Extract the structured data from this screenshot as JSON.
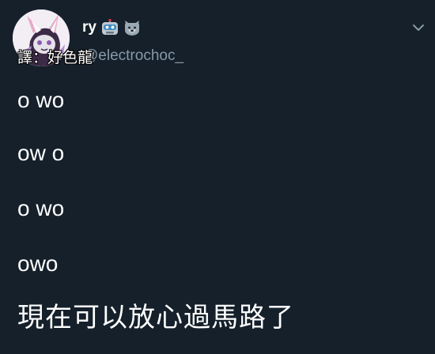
{
  "author": {
    "display_name": "ry",
    "handle": "@electrochoc_",
    "avatar_icon": "dragon-avatar-icon",
    "name_emojis": [
      "robot-face-icon",
      "wolf-face-icon"
    ]
  },
  "overlay": {
    "translator_label": "譯：好色龍"
  },
  "menu": {
    "icon": "chevron-down-icon"
  },
  "tweet": {
    "lines": [
      "o wo",
      "ow o",
      "o wo",
      "owo",
      "現在可以放心過馬路了"
    ]
  },
  "colors": {
    "background": "#15202b",
    "text_primary": "#ffffff",
    "text_secondary": "#8899a6"
  }
}
